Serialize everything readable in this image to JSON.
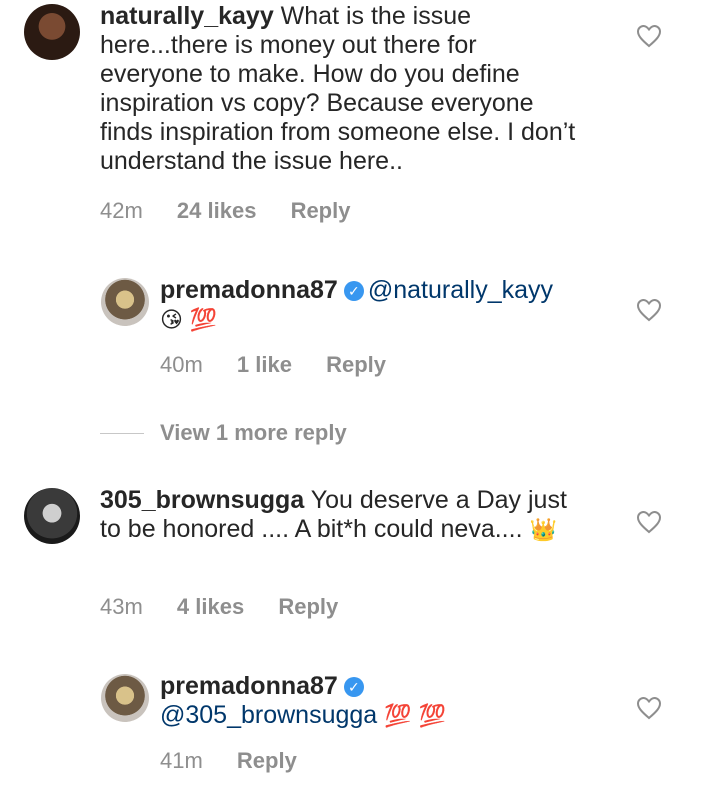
{
  "comments": [
    {
      "username": "naturally_kayy",
      "text": "What is the  issue here...there is money out there for everyone to make. How do you define inspiration vs copy? Because everyone finds inspiration from someone else. I don’t understand the issue here..",
      "time": "42m",
      "likes": "24 likes",
      "reply": "Reply"
    },
    {
      "username": "premadonna87",
      "mention": "@naturally_kayy",
      "emoji": "😘",
      "hundred": "💯",
      "time": "40m",
      "likes": "1 like",
      "reply": "Reply"
    },
    {
      "view_more": "View 1 more reply"
    },
    {
      "username": "305_brownsugga",
      "text": "You deserve a Day just to be honored .... A bit*h could neva....",
      "emoji": "👑",
      "time": "43m",
      "likes": "4 likes",
      "reply": "Reply"
    },
    {
      "username": "premadonna87",
      "mention": "@305_brownsugga",
      "hundred": "💯",
      "hundred2": "💯",
      "time": "41m",
      "reply": "Reply"
    }
  ],
  "icons": {
    "heart": "heart-icon",
    "verified": "verified-badge-icon"
  }
}
